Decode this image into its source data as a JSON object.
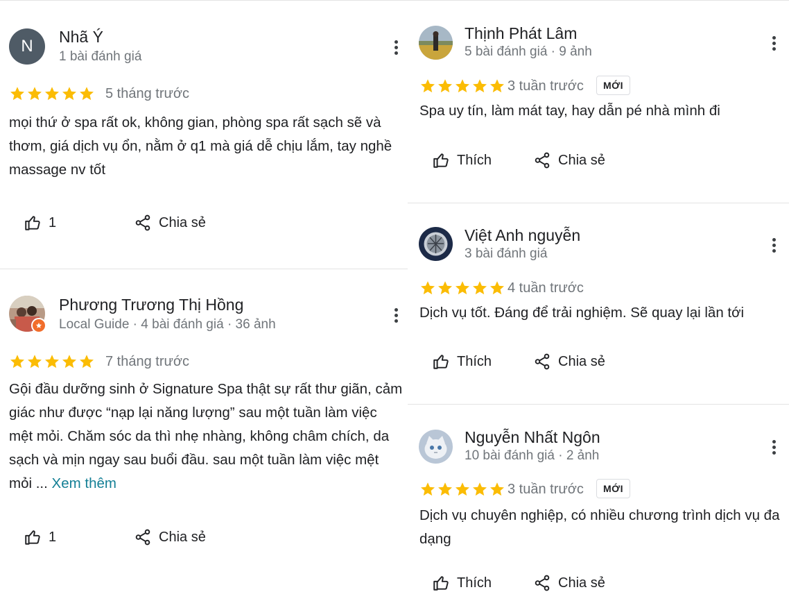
{
  "left": [
    {
      "name": "Nhã Ý",
      "meta": "1 bài đánh giá",
      "avatar_letter": "N",
      "avatar_color": "#4f5b66",
      "rating": 5,
      "time": "5 tháng trước",
      "text": "mọi thứ ở spa rất ok, không gian, phòng spa rất sạch sẽ và thơm, giá dịch vụ ổn, nằm ở q1 mà giá dễ chịu lắm, tay nghề massage nv tốt",
      "like_label": "1",
      "share_label": "Chia sẻ"
    },
    {
      "name": "Phương Trương Thị Hồng",
      "meta": "Local Guide · 4 bài đánh giá · 36 ảnh",
      "rating": 5,
      "time": "7 tháng trước",
      "text": "Gội đầu dưỡng sinh ở Signature Spa thật sự rất thư giãn, cảm giác như được “nạp lại năng lượng” sau một tuần làm việc mệt mỏi. Chăm sóc da thì nhẹ nhàng, không châm chích, da sạch và mịn ngay sau buổi đầu. sau một tuần làm việc mệt mỏi ...",
      "see_more": "Xem thêm",
      "like_label": "1",
      "share_label": "Chia sẻ"
    }
  ],
  "right": [
    {
      "name": "Thịnh Phát Lâm",
      "meta": "5 bài đánh giá · 9 ảnh",
      "rating": 5,
      "time": "3 tuần trước",
      "badge": "MỚI",
      "text": "Spa uy tín, làm mát tay, hay dẫn pé nhà mình đi",
      "like_label": "Thích",
      "share_label": "Chia sẻ"
    },
    {
      "name": "Việt Anh nguyễn",
      "meta": "3 bài đánh giá",
      "rating": 5,
      "time": "4 tuần trước",
      "text": "Dịch vụ tốt. Đáng để trải nghiệm. Sẽ quay lại lần tới",
      "like_label": "Thích",
      "share_label": "Chia sẻ"
    },
    {
      "name": "Nguyễn Nhất Ngôn",
      "meta": "10 bài đánh giá · 2 ảnh",
      "rating": 5,
      "time": "3 tuần trước",
      "badge": "MỚI",
      "text": "Dịch vụ chuyên nghiệp, có nhiều chương trình dịch vụ đa dạng",
      "like_label": "Thích",
      "share_label": "Chia sẻ"
    }
  ],
  "colors": {
    "star": "#fbbc04",
    "divider": "#e3e3e3",
    "link": "#137f95"
  },
  "icons": [
    "more-vert-icon",
    "star-icon",
    "thumb-up-icon",
    "share-icon",
    "local-guide-badge-icon"
  ]
}
